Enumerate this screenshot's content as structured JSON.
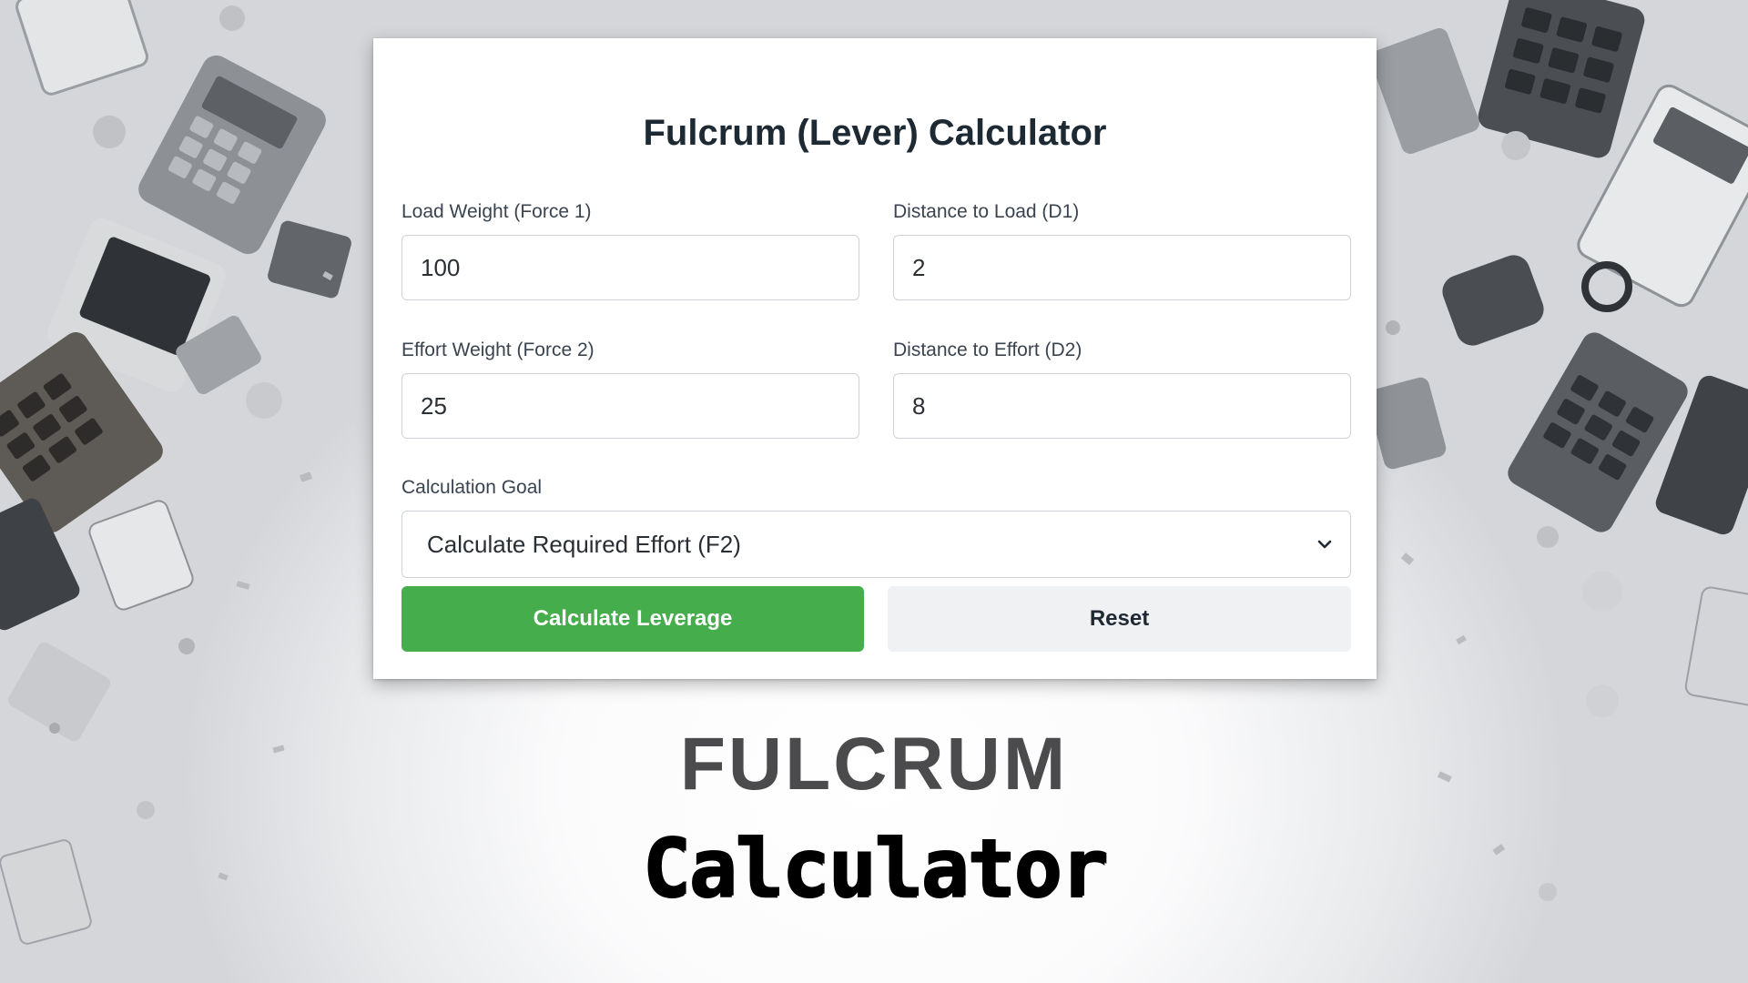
{
  "calculator": {
    "title": "Fulcrum (Lever) Calculator",
    "fields": [
      {
        "label": "Load Weight (Force 1)",
        "value": "100"
      },
      {
        "label": "Distance to Load (D1)",
        "value": "2"
      },
      {
        "label": "Effort Weight (Force 2)",
        "value": "25"
      },
      {
        "label": "Distance to Effort (D2)",
        "value": "8"
      }
    ],
    "goal": {
      "label": "Calculation Goal",
      "selected": "Calculate Required Effort (F2)"
    },
    "buttons": {
      "calculate": "Calculate Leverage",
      "reset": "Reset"
    }
  },
  "banner": {
    "headline": "FULCRUM",
    "subline": "Calculator"
  },
  "colors": {
    "primary_button": "#45ad4c",
    "secondary_button": "#f0f1f3",
    "title_text": "#1e2a33",
    "headline_text": "#4b4b4d"
  },
  "icons": {
    "select_arrow": "chevron-down-icon"
  }
}
